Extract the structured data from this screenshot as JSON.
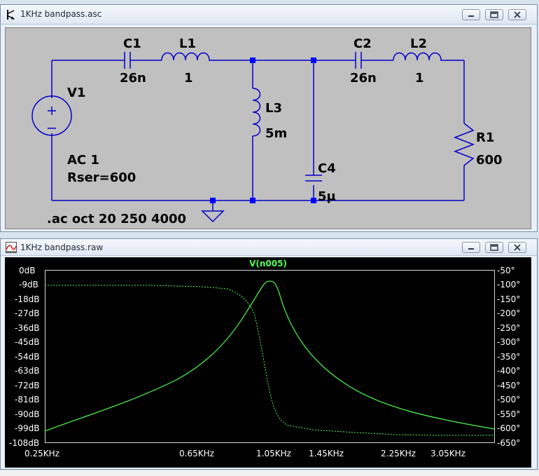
{
  "schematic_window": {
    "title": "1KHz bandpass.asc",
    "components": {
      "c1": {
        "name": "C1",
        "value": "26n"
      },
      "l1": {
        "name": "L1",
        "value": "1"
      },
      "c2": {
        "name": "C2",
        "value": "26n"
      },
      "l2": {
        "name": "L2",
        "value": "1"
      },
      "l3": {
        "name": "L3",
        "value": "5m"
      },
      "c4": {
        "name": "C4",
        "value": "5μ"
      },
      "v1": {
        "name": "V1",
        "ac": "AC 1",
        "rser": "Rser=600"
      },
      "r1": {
        "name": "R1",
        "value": "600"
      }
    },
    "directive": ".ac oct 20 250 4000"
  },
  "plot_window": {
    "title": "1KHz bandpass.raw",
    "trace_label": "V(n005)",
    "left_axis": [
      "0dB",
      "-9dB",
      "-18dB",
      "-27dB",
      "-36dB",
      "-45dB",
      "-54dB",
      "-63dB",
      "-72dB",
      "-81dB",
      "-90dB",
      "-99dB",
      "-108dB"
    ],
    "right_axis": [
      "-50°",
      "-100°",
      "-150°",
      "-200°",
      "-250°",
      "-300°",
      "-350°",
      "-400°",
      "-450°",
      "-500°",
      "-550°",
      "-600°",
      "-650°"
    ],
    "x_axis": [
      "0.25KHz",
      "0.65KHz",
      "1.05KHz",
      "1.45KHz",
      "2.25KHz",
      "3.05KHz"
    ]
  },
  "colors": {
    "wire": "#0000c8",
    "node": "#0000ff",
    "trace": "#50ff50",
    "plot_bg": "#000000",
    "schematic_bg": "#c0c0c0"
  },
  "icons": {
    "schematic": "transistor-icon",
    "plot": "waveform-icon"
  }
}
